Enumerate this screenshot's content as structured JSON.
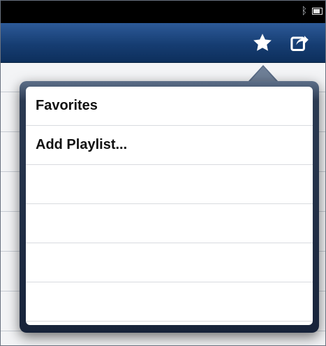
{
  "status_bar": {
    "bluetooth_icon": "bluetooth-icon",
    "battery_icon": "battery-icon"
  },
  "nav_bar": {
    "actions": [
      {
        "icon": "star-icon"
      },
      {
        "icon": "share-icon"
      }
    ],
    "colors": {
      "top": "#2d5a98",
      "bottom": "#0d2f5c"
    }
  },
  "popover": {
    "items": [
      {
        "label": "Favorites"
      },
      {
        "label": "Add Playlist..."
      },
      {
        "label": ""
      },
      {
        "label": ""
      },
      {
        "label": ""
      },
      {
        "label": ""
      }
    ]
  }
}
